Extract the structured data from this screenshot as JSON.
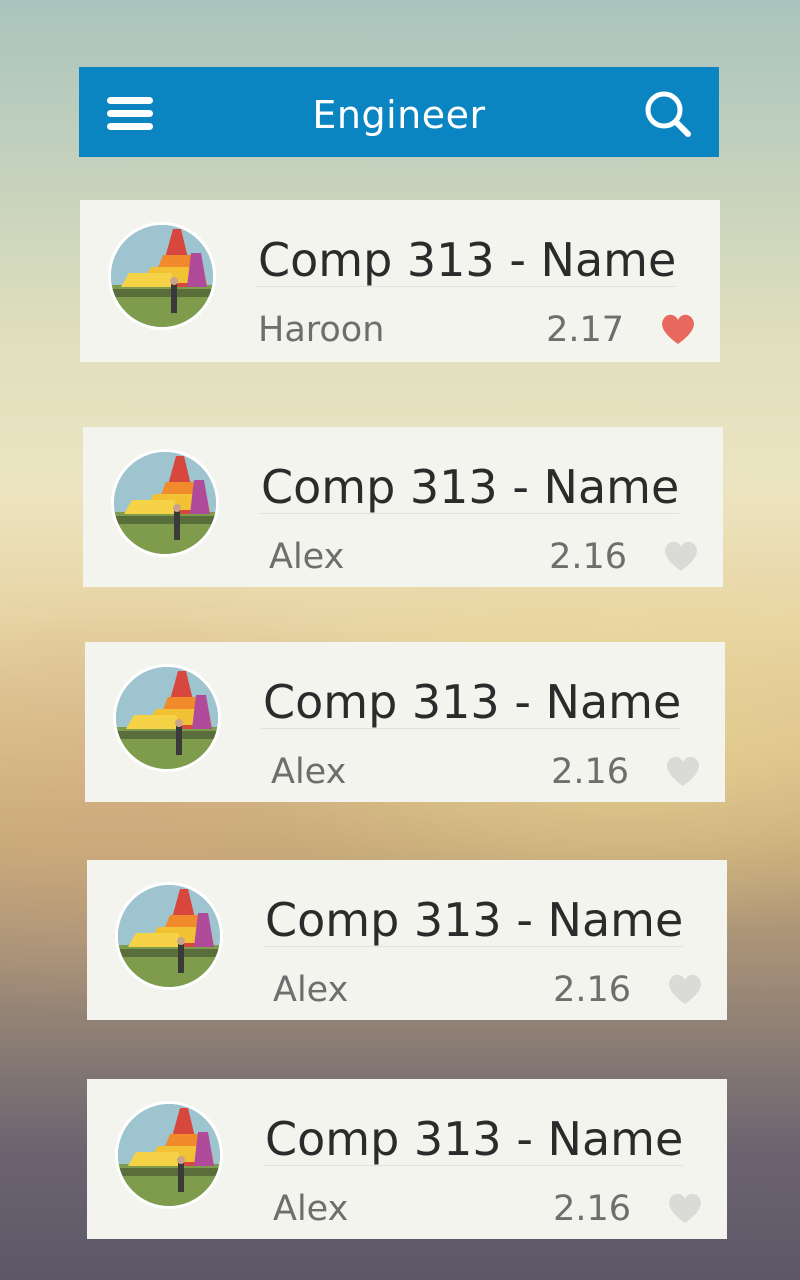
{
  "header": {
    "title": "Engineer",
    "menu_icon": "hamburger-menu-icon",
    "search_icon": "search-icon",
    "background_color": "#0a85c1"
  },
  "items": [
    {
      "course": "Comp 313 - Name",
      "author": "Haroon",
      "score": "2.17",
      "favorited": true
    },
    {
      "course": "Comp 313 - Name",
      "author": "Alex",
      "score": "2.16",
      "favorited": false
    },
    {
      "course": "Comp 313 - Name",
      "author": "Alex",
      "score": "2.16",
      "favorited": false
    },
    {
      "course": "Comp 313 - Name",
      "author": "Alex",
      "score": "2.16",
      "favorited": false
    },
    {
      "course": "Comp 313 - Name",
      "author": "Alex",
      "score": "2.16",
      "favorited": false
    }
  ],
  "colors": {
    "heart_active": "#e8685e",
    "heart_inactive": "#dadad6",
    "card_background": "#f4f4ef"
  }
}
